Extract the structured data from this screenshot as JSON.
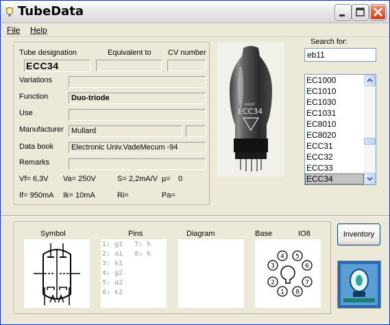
{
  "window": {
    "title": "TubeData"
  },
  "menu": {
    "file": "File",
    "help": "Help"
  },
  "labels": {
    "tube_designation": "Tube designation",
    "equivalent_to": "Equivalent to",
    "cv_number": "CV number",
    "variations": "Variations",
    "function": "Function",
    "use": "Use",
    "manufacturer": "Manufacturer",
    "data_book": "Data book",
    "remarks": "Remarks"
  },
  "fields": {
    "tube_designation": "ECC34",
    "equivalent_to": "",
    "cv_number": "",
    "variations": "",
    "function": "Duo-triode",
    "use": "",
    "manufacturer": "Mullard",
    "manufacturer_extra": "",
    "data_book": "Electronic Univ.VadeMecum -94",
    "remarks": ""
  },
  "params": {
    "vf": "Vf= 6,3V",
    "va": "Va= 250V",
    "s": "S= 2,2mA/V",
    "mu": "µ=",
    "mu_val": "0",
    "if": "If= 950mA",
    "ik": "Ik= 10mA",
    "ri": "Ri=",
    "pa": "Pa="
  },
  "photo": {
    "tube_text": "ECC34",
    "small_text": "IMPORT"
  },
  "search": {
    "label": "Search for:",
    "value": "eb11"
  },
  "tube_list": {
    "items": [
      "EC1000",
      "EC1010",
      "EC1030",
      "EC1031",
      "EC8010",
      "EC8020",
      "ECC31",
      "ECC32",
      "ECC33",
      "ECC34"
    ],
    "selected": "ECC34"
  },
  "bottom": {
    "symbol": "Symbol",
    "pins": "Pins",
    "diagram": "Diagram",
    "base": "Base",
    "base_type": "IO8",
    "pins_col1": [
      "1: g1",
      "2: a1",
      "3: k1",
      "4: g2",
      "5: a2",
      "6: k2"
    ],
    "pins_col2": [
      "7: h",
      "8: h"
    ],
    "base_pins": [
      "1",
      "2",
      "3",
      "4",
      "5",
      "6",
      "7",
      "8"
    ]
  },
  "buttons": {
    "inventory": "Inventory"
  },
  "colors": {
    "title_bar": "#ececec",
    "window_bg": "#ece9d8",
    "selected_item": "#c2c2c2",
    "close_button": "#d0401c"
  }
}
